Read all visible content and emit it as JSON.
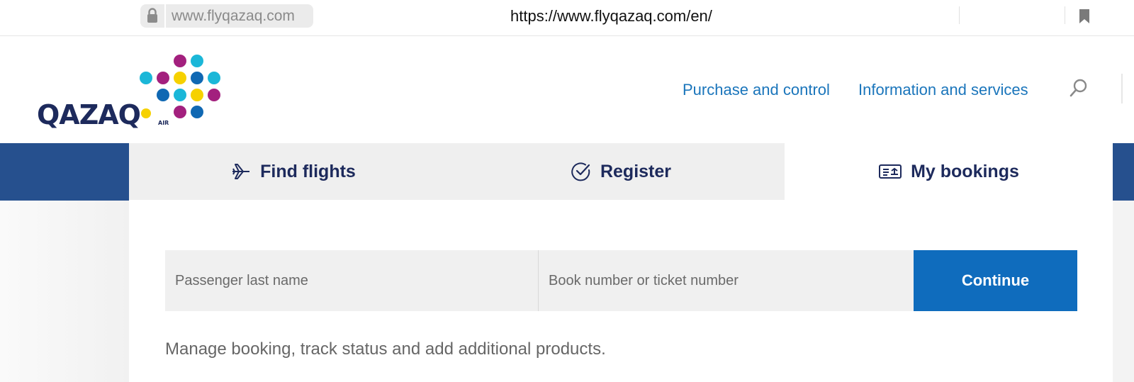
{
  "browser": {
    "domain_chip": "www.flyqazaq.com",
    "url": "https://www.flyqazaq.com/en/"
  },
  "header": {
    "logo_text": "QAZAQ",
    "logo_subtext": "AIR",
    "nav": [
      {
        "label": "Purchase and control"
      },
      {
        "label": "Information and services"
      }
    ]
  },
  "tabs": [
    {
      "label": "Find flights",
      "icon": "airplane-icon",
      "active": false
    },
    {
      "label": "Register",
      "icon": "check-circle-icon",
      "active": false
    },
    {
      "label": "My bookings",
      "icon": "ticket-icon",
      "active": true
    }
  ],
  "form": {
    "last_name_placeholder": "Passenger last name",
    "last_name_value": "",
    "booking_placeholder": "Book number or ticket number",
    "booking_value": "",
    "continue_label": "Continue"
  },
  "helper_text": "Manage booking, track status and add additional products.",
  "colors": {
    "brand_navy": "#1d2a5c",
    "band_blue": "#26508e",
    "link_blue": "#1a75bb",
    "button_blue": "#0f6cbd",
    "dot_magenta": "#a3207e",
    "dot_cyan": "#1bb7d8",
    "dot_yellow": "#f6d100",
    "dot_blue": "#1068b3"
  }
}
